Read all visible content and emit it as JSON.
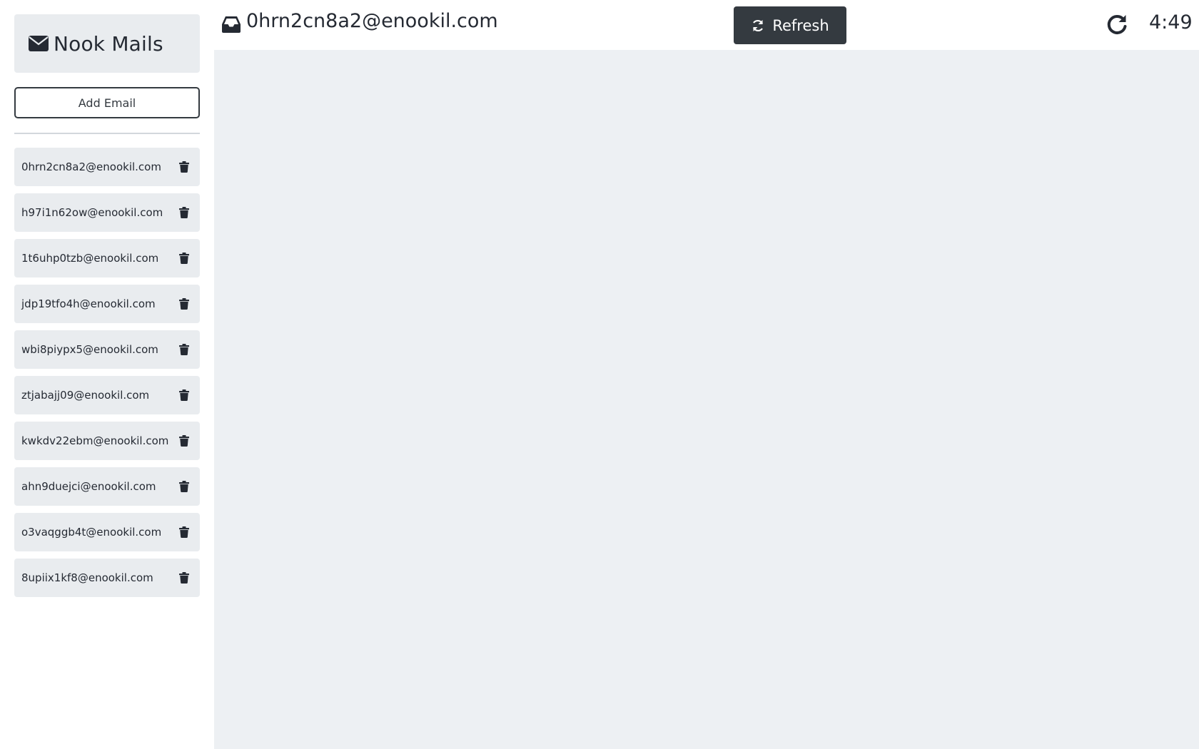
{
  "brand": {
    "title": "Nook Mails",
    "icon": "envelope-icon"
  },
  "sidebar": {
    "add_email_label": "Add Email",
    "emails": [
      "0hrn2cn8a2@enookil.com",
      "h97i1n62ow@enookil.com",
      "1t6uhp0tzb@enookil.com",
      "jdp19tfo4h@enookil.com",
      "wbi8piypx5@enookil.com",
      "ztjabajj09@enookil.com",
      "kwkdv22ebm@enookil.com",
      "ahn9duejci@enookil.com",
      "o3vaqggb4t@enookil.com",
      "8upiix1kf8@enookil.com"
    ],
    "item_icon": "trash-icon"
  },
  "header": {
    "current_address": "0hrn2cn8a2@enookil.com",
    "inbox_icon": "inbox-icon",
    "refresh_label": "Refresh",
    "refresh_icon": "sync-icon",
    "reload_icon": "redo-icon",
    "timer": "4:49"
  },
  "colors": {
    "dark": "#343a40",
    "text": "#252a33",
    "panel": "#e9ecef",
    "main_bg": "#edf0f3"
  }
}
